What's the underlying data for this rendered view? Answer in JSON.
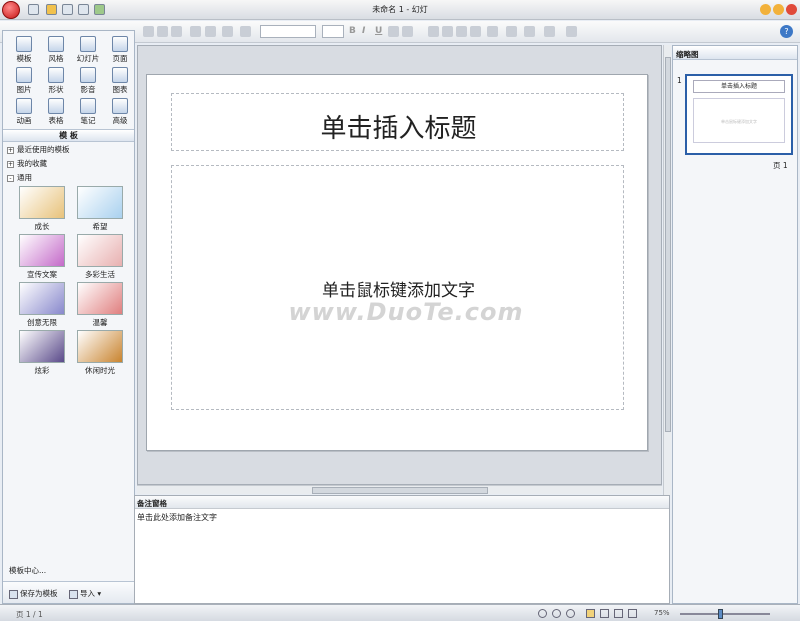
{
  "window": {
    "title": "未命名 1 - 幻灯"
  },
  "left_panel": {
    "tools": [
      {
        "label": "模板"
      },
      {
        "label": "风格"
      },
      {
        "label": "幻灯片"
      },
      {
        "label": "页面"
      },
      {
        "label": "图片"
      },
      {
        "label": "形状"
      },
      {
        "label": "影音"
      },
      {
        "label": "图表"
      },
      {
        "label": "动画"
      },
      {
        "label": "表格"
      },
      {
        "label": "笔记"
      },
      {
        "label": "高级"
      }
    ],
    "template_header": "模 板",
    "tree": [
      {
        "sign": "+",
        "label": "最近使用的模板"
      },
      {
        "sign": "+",
        "label": "我的收藏"
      },
      {
        "sign": "-",
        "label": "通用"
      }
    ],
    "thumbnails": [
      {
        "label": "成长",
        "color": "#e8c27a"
      },
      {
        "label": "希望",
        "color": "#a9d1ef"
      },
      {
        "label": "宣传文案",
        "color": "#c46ac9"
      },
      {
        "label": "多彩生活",
        "color": "#e8b0b0"
      },
      {
        "label": "创意无限",
        "color": "#8888cc"
      },
      {
        "label": "温馨",
        "color": "#e07f7f"
      },
      {
        "label": "炫彩",
        "color": "#5a4a8a"
      },
      {
        "label": "休闲时光",
        "color": "#c9842f"
      }
    ],
    "template_center": "模板中心...",
    "save_label": "保存为模板",
    "import_label": "导入"
  },
  "slide": {
    "title": "单击插入标题",
    "body": "单击鼠标键添加文字",
    "watermark": "www.DuoTe.com"
  },
  "notes": {
    "header": "备注窗格",
    "placeholder": "单击此处添加备注文字"
  },
  "right_panel": {
    "header": "缩略图",
    "slide_number": "1",
    "mini_title": "单击插入标题",
    "mini_body": "单击鼠标键添加文字",
    "page_label": "页 1"
  },
  "status": {
    "page": "页 1 / 1",
    "zoom": "75%"
  },
  "colors": {
    "accent": "#2b5fa8",
    "logo": "#c81414"
  }
}
